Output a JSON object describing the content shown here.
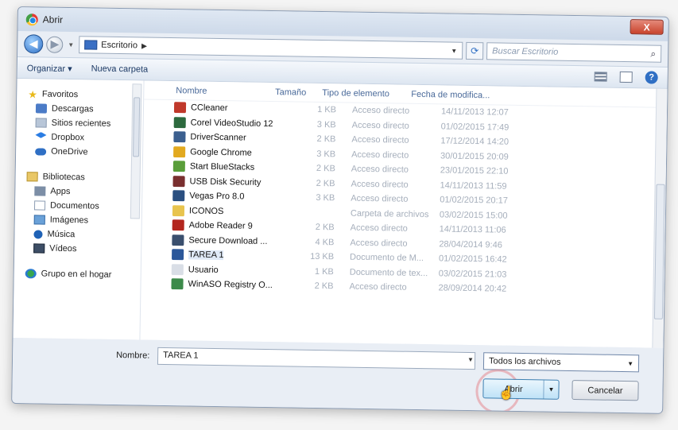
{
  "window": {
    "title": "Abrir",
    "close_label": "X"
  },
  "address": {
    "breadcrumb": "Escritorio",
    "search_placeholder": "Buscar Escritorio"
  },
  "toolbar": {
    "organize_label": "Organizar ▾",
    "new_folder_label": "Nueva carpeta"
  },
  "sidebar": {
    "favorites": {
      "label": "Favoritos",
      "items": [
        {
          "label": "Descargas",
          "icon": "downloads-icon"
        },
        {
          "label": "Sitios recientes",
          "icon": "recent-places-icon"
        },
        {
          "label": "Dropbox",
          "icon": "dropbox-icon"
        },
        {
          "label": "OneDrive",
          "icon": "onedrive-icon"
        }
      ]
    },
    "libraries": {
      "label": "Bibliotecas",
      "items": [
        {
          "label": "Apps",
          "icon": "apps-icon"
        },
        {
          "label": "Documentos",
          "icon": "documents-icon"
        },
        {
          "label": "Imágenes",
          "icon": "images-icon"
        },
        {
          "label": "Música",
          "icon": "music-icon"
        },
        {
          "label": "Vídeos",
          "icon": "videos-icon"
        }
      ]
    },
    "homegroup": {
      "label": "Grupo en el hogar"
    }
  },
  "columns": {
    "name": "Nombre",
    "size": "Tamaño",
    "type": "Tipo de elemento",
    "date": "Fecha de modifica..."
  },
  "files": [
    {
      "name": "CCleaner",
      "size": "1 KB",
      "type": "Acceso directo",
      "date": "14/11/2013 12:07",
      "color": "#c0392b"
    },
    {
      "name": "Corel VideoStudio 12",
      "size": "3 KB",
      "type": "Acceso directo",
      "date": "01/02/2015 17:49",
      "color": "#2d6a3e"
    },
    {
      "name": "DriverScanner",
      "size": "2 KB",
      "type": "Acceso directo",
      "date": "17/12/2014 14:20",
      "color": "#3b5f8f"
    },
    {
      "name": "Google Chrome",
      "size": "3 KB",
      "type": "Acceso directo",
      "date": "30/01/2015 20:09",
      "color": "#e2a91f"
    },
    {
      "name": "Start BlueStacks",
      "size": "2 KB",
      "type": "Acceso directo",
      "date": "23/01/2015 22:10",
      "color": "#5a9e3a"
    },
    {
      "name": "USB Disk Security",
      "size": "2 KB",
      "type": "Acceso directo",
      "date": "14/11/2013 11:59",
      "color": "#7a2f2f"
    },
    {
      "name": "Vegas Pro 8.0",
      "size": "3 KB",
      "type": "Acceso directo",
      "date": "01/02/2015 20:17",
      "color": "#2a4f80"
    },
    {
      "name": "ICONOS",
      "size": "",
      "type": "Carpeta de archivos",
      "date": "03/02/2015 15:00",
      "color": "#e8c44e"
    },
    {
      "name": "Adobe Reader 9",
      "size": "2 KB",
      "type": "Acceso directo",
      "date": "14/11/2013 11:06",
      "color": "#b3261e"
    },
    {
      "name": "Secure Download ...",
      "size": "4 KB",
      "type": "Acceso directo",
      "date": "28/04/2014 9:46",
      "color": "#3a4f6e"
    },
    {
      "name": "TAREA 1",
      "size": "13 KB",
      "type": "Documento de M...",
      "date": "01/02/2015 16:42",
      "color": "#2b579a"
    },
    {
      "name": "Usuario",
      "size": "1 KB",
      "type": "Documento de tex...",
      "date": "03/02/2015 21:03",
      "color": "#d9dee6"
    },
    {
      "name": "WinASO Registry O...",
      "size": "2 KB",
      "type": "Acceso directo",
      "date": "28/09/2014 20:42",
      "color": "#3c8a4a"
    }
  ],
  "footer": {
    "name_label": "Nombre:",
    "name_value": "TAREA 1",
    "filter_value": "Todos los archivos",
    "open_label": "Abrir",
    "cancel_label": "Cancelar"
  }
}
